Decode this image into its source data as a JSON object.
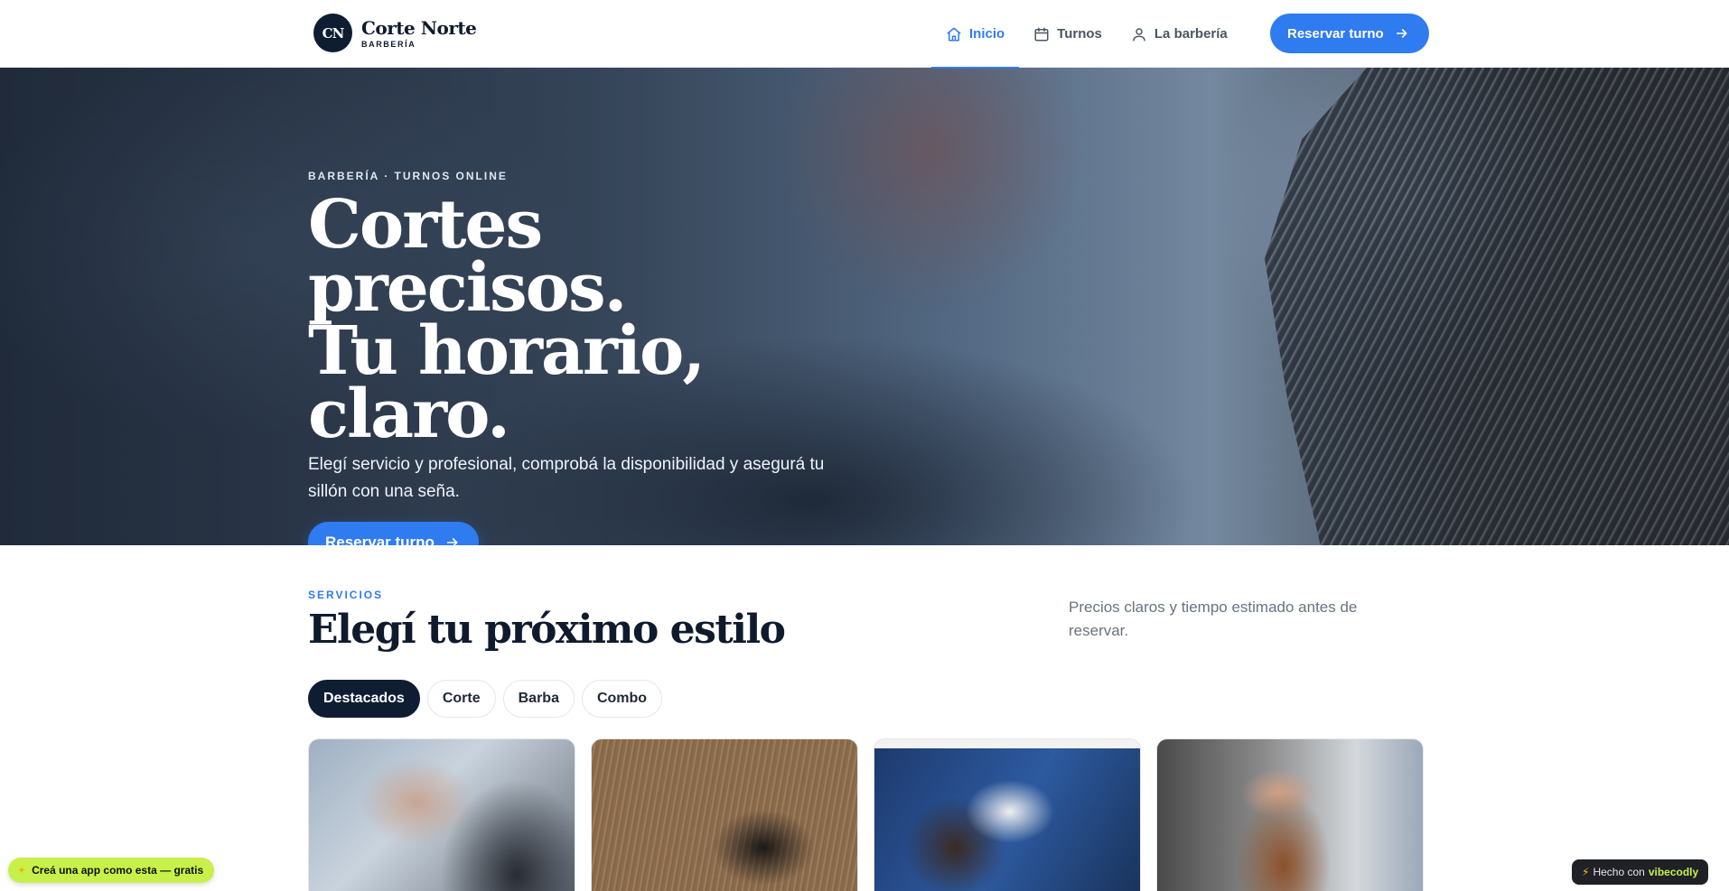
{
  "header": {
    "logo_initials": "CN",
    "brand_name": "Corte Norte",
    "brand_sub": "BARBERÍA",
    "nav": [
      {
        "label": "Inicio",
        "icon": "home-icon",
        "active": true
      },
      {
        "label": "Turnos",
        "icon": "calendar-icon",
        "active": false
      },
      {
        "label": "La barbería",
        "icon": "user-icon",
        "active": false
      }
    ],
    "cta_label": "Reservar turno"
  },
  "hero": {
    "eyebrow": "BARBERÍA · TURNOS ONLINE",
    "title_line1": "Cortes precisos.",
    "title_line2": "Tu horario, claro.",
    "subtitle": "Elegí servicio y profesional, comprobá la disponibilidad y asegurá tu sillón con una seña.",
    "cta_label": "Reservar turno"
  },
  "services": {
    "eyebrow": "SERVICIOS",
    "title": "Elegí tu próximo estilo",
    "description": "Precios claros y tiempo estimado antes de reservar.",
    "filters": [
      {
        "label": "Destacados",
        "active": true
      },
      {
        "label": "Corte",
        "active": false
      },
      {
        "label": "Barba",
        "active": false
      },
      {
        "label": "Combo",
        "active": false
      }
    ]
  },
  "badges": {
    "promo": "Creá una app como esta — gratis",
    "made_prefix": "Hecho con",
    "made_brand": "vibecodly"
  },
  "colors": {
    "accent": "#2f7bf0",
    "navy": "#0f1d33",
    "promo_bg": "#c8f04a"
  }
}
